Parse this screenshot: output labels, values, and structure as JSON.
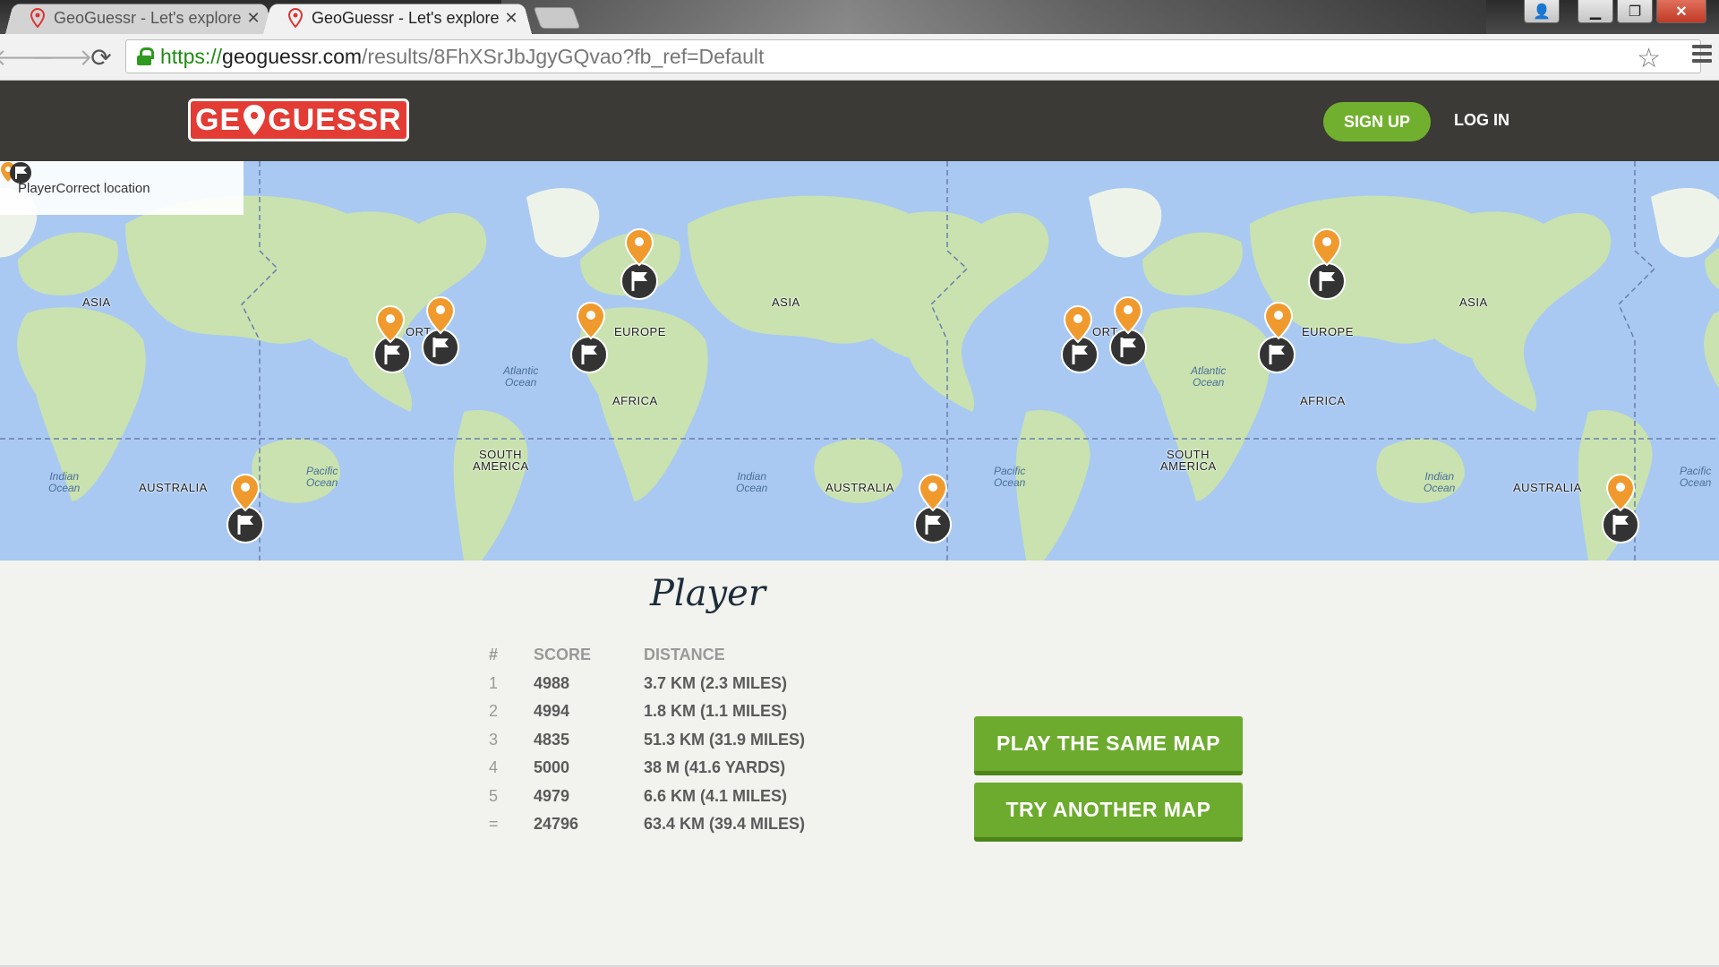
{
  "browser": {
    "tabs": [
      {
        "title": "GeoGuessr - Let's explore",
        "close": "✕",
        "active": false
      },
      {
        "title": "GeoGuessr - Let's explore",
        "close": "✕",
        "active": true
      }
    ],
    "url": {
      "scheme": "https://",
      "host": "geoguessr.com",
      "path": "/results/8FhXSrJbJgyGQvao?fb_ref=Default"
    },
    "icons": {
      "back": "arrow-left-icon",
      "forward": "arrow-right-icon",
      "reload": "reload-icon",
      "bookmark": "star-icon",
      "menu": "hamburger-icon",
      "lock": "lock-icon"
    },
    "glyphs": {
      "back": "🡐",
      "forward": "🡒",
      "reload": "⟳",
      "star": "☆",
      "minimize": "▁",
      "restore": "❐",
      "close": "✕",
      "user": "👤"
    }
  },
  "header": {
    "logo_left": "GE",
    "logo_right": "GUESSR",
    "signup": "SIGN UP",
    "login": "LOG IN"
  },
  "map": {
    "legend": {
      "player": "Player",
      "correct": "Correct location"
    },
    "labels": {
      "asia": "ASIA",
      "europe": "EUROPE",
      "africa": "AFRICA",
      "australia": "AUSTRALIA",
      "south_america_1": "SOUTH",
      "south_america_2": "AMERICA",
      "north_fragment": "ORT",
      "atlantic_1": "Atlantic",
      "atlantic_2": "Ocean",
      "pacific_1": "Pacific",
      "pacific_2": "Ocean",
      "indian_1": "Indian",
      "indian_2": "Ocean"
    },
    "colors": {
      "water": "#a9c9f2",
      "land": "#c9e2b0",
      "player_marker": "#f09a2e",
      "correct_marker": "#333333"
    }
  },
  "results": {
    "title": "Player",
    "columns": {
      "rank": "#",
      "score": "SCORE",
      "distance": "DISTANCE"
    },
    "rows": [
      {
        "rank": "1",
        "score": "4988",
        "distance": "3.7 KM (2.3 MILES)"
      },
      {
        "rank": "2",
        "score": "4994",
        "distance": "1.8 KM (1.1 MILES)"
      },
      {
        "rank": "3",
        "score": "4835",
        "distance": "51.3 KM (31.9 MILES)"
      },
      {
        "rank": "4",
        "score": "5000",
        "distance": "38 M (41.6 YARDS)"
      },
      {
        "rank": "5",
        "score": "4979",
        "distance": "6.6 KM (4.1 MILES)"
      },
      {
        "rank": "=",
        "score": "24796",
        "distance": "63.4 KM (39.4 MILES)"
      }
    ],
    "play_same": "PLAY THE SAME MAP",
    "try_another": "TRY ANOTHER MAP"
  }
}
